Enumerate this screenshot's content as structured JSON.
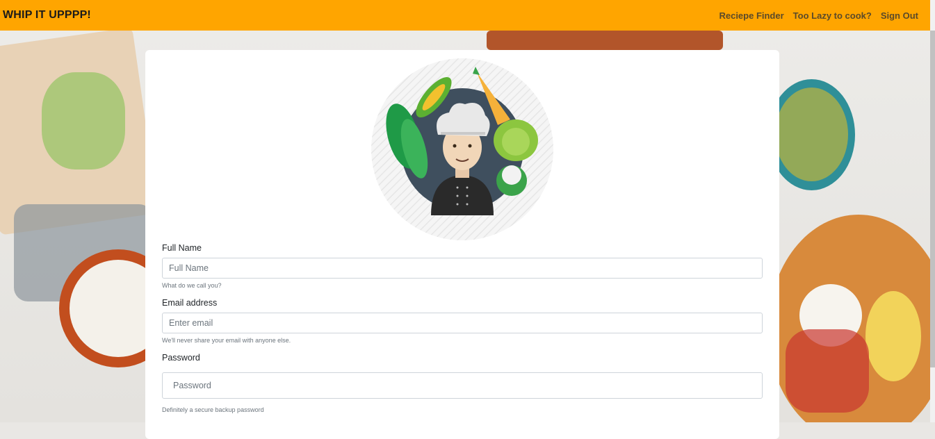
{
  "navbar": {
    "brand": "WHIP IT UPPPP!",
    "links": [
      "Reciepe Finder",
      "Too Lazy to cook?",
      "Sign Out"
    ],
    "color": "#ffa500"
  },
  "logo": {
    "icon": "chef-icon"
  },
  "form": {
    "full_name": {
      "label": "Full Name",
      "placeholder": "Full Name",
      "help": "What do we call you?"
    },
    "email": {
      "label": "Email address",
      "placeholder": "Enter email",
      "help": "We'll never share your email with anyone else."
    },
    "password": {
      "label": "Password",
      "placeholder": "Password",
      "help": "Definitely a secure backup password"
    }
  }
}
